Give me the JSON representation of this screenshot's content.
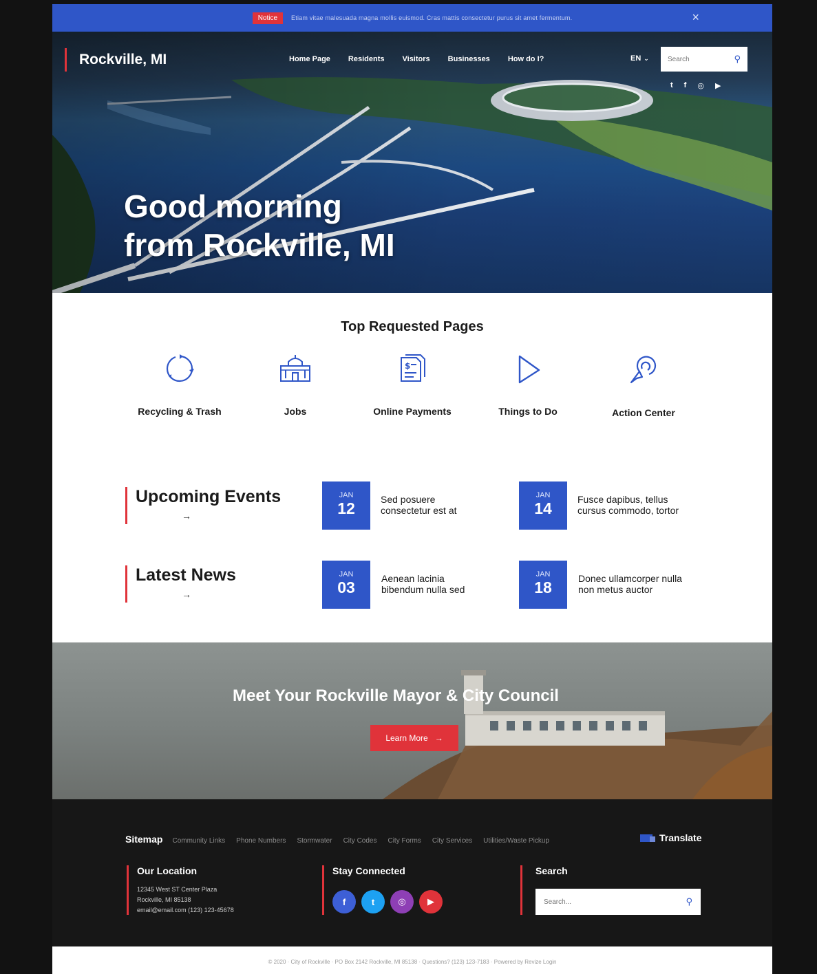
{
  "notice": {
    "tag": "Notice",
    "text": "Etiam vitae malesuada magna mollis euismod. Cras mattis consectetur purus sit amet fermentum.",
    "close": "×"
  },
  "header": {
    "brand": "Rockville, MI",
    "nav": [
      "Home Page",
      "Residents",
      "Visitors",
      "Businesses",
      "How do I?"
    ],
    "language": "EN",
    "search_placeholder": "Search"
  },
  "hero": {
    "line1": "Good morning",
    "line2": "from Rockville, MI"
  },
  "top_requested": {
    "title": "Top Requested Pages",
    "items": [
      {
        "label": "Recycling & Trash",
        "icon": "recycle-icon"
      },
      {
        "label": "Jobs",
        "icon": "building-icon"
      },
      {
        "label": "Online Payments",
        "icon": "payment-document-icon"
      },
      {
        "label": "Things to Do",
        "icon": "play-icon"
      },
      {
        "label": "Action Center",
        "icon": "action-pointer-icon"
      }
    ]
  },
  "events": {
    "title": "Upcoming Events",
    "arrow": "→",
    "items": [
      {
        "month": "JAN",
        "day": "12",
        "line1": "Sed posuere",
        "line2": "consectetur est at"
      },
      {
        "month": "JAN",
        "day": "14",
        "line1": "Fusce dapibus, tellus",
        "line2": "cursus commodo, tortor"
      }
    ]
  },
  "news": {
    "title": "Latest News",
    "arrow": "→",
    "items": [
      {
        "month": "JAN",
        "day": "03",
        "line1": "Aenean lacinia",
        "line2": "bibendum nulla sed"
      },
      {
        "month": "JAN",
        "day": "18",
        "line1": "Donec ullamcorper nulla",
        "line2": "non metus auctor"
      }
    ]
  },
  "mayor": {
    "title": "Meet Your Rockville Mayor & City Council",
    "button": "Learn More",
    "button_arrow": "→"
  },
  "footer": {
    "sitemap_title": "Sitemap",
    "sitemap_links": [
      "Community Links",
      "Phone Numbers",
      "Stormwater",
      "City Codes",
      "City Forms",
      "City Services",
      "Utilities/Waste Pickup"
    ],
    "translate": "Translate",
    "location": {
      "title": "Our Location",
      "address1": "12345 West ST Center Plaza",
      "address2": "Rockville, MI 85138",
      "contact": "email@email.com (123) 123-45678"
    },
    "stay_connected": "Stay Connected",
    "search_title": "Search",
    "search_placeholder": "Search...",
    "copyright": "© 2020 · City of Rockville · PO Box 2142 Rockville, MI 85138 · Questions? (123) 123-7183 · Powered by Revize Login"
  },
  "colors": {
    "primary_blue": "#2f56c8",
    "accent_red": "#e0333a",
    "footer_bg": "#171717",
    "facebook": "#3d5fd6",
    "twitter": "#1da1f2",
    "instagram": "#8e3fb5",
    "youtube": "#e0333a"
  }
}
